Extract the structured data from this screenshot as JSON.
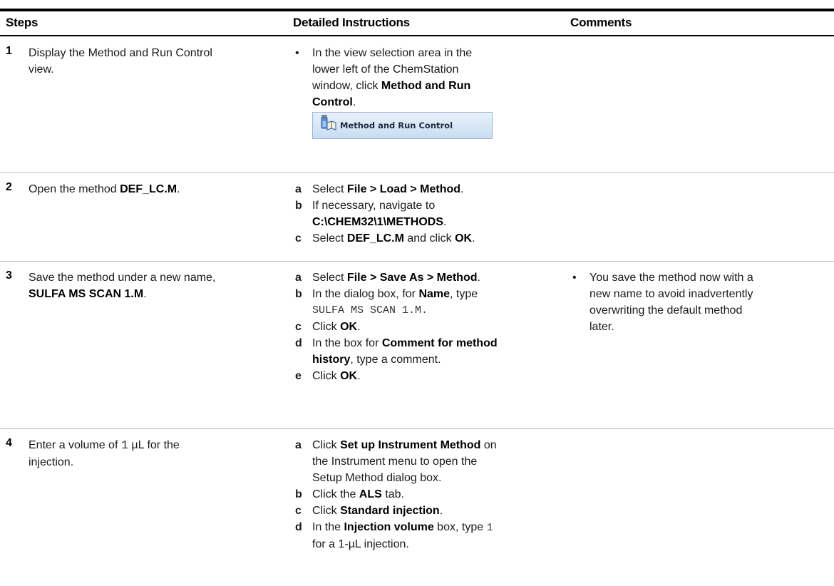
{
  "header": {
    "steps": "Steps",
    "instructions": "Detailed Instructions",
    "comments": "Comments"
  },
  "rows": [
    {
      "num": "1",
      "step_lines": [
        "Display the Method and Run Control",
        "view."
      ],
      "bullet": "•",
      "instr_line1": "In the view selection area in the",
      "instr_line2": "lower left of the ChemStation",
      "instr_line3a": "window, click ",
      "instr_bold1": "Method and Run",
      "instr_bold2": "Control",
      "instr_end": ".",
      "button_image_label": "Method and Run Control",
      "icon": "method-vial-book-icon"
    },
    {
      "num": "2",
      "step_a": "Open the method ",
      "step_b": "DEF_LC.M",
      "step_c": ".",
      "items": [
        {
          "letter": "a",
          "t1": "Select ",
          "b1": "File > Load > Method",
          "t2": "."
        },
        {
          "letter": "b",
          "t1": "If necessary, navigate to",
          "b1": "C:\\CHEM32\\1\\METHODS",
          "t2": "."
        },
        {
          "letter": "c",
          "t1": "Select ",
          "b1": "DEF_LC.M",
          "t2": " and click ",
          "b2": "OK",
          "t3": "."
        }
      ]
    },
    {
      "num": "3",
      "step_line1": "Save the method under a new name,",
      "step_bold": "SULFA MS SCAN 1.M",
      "step_end": ".",
      "items": [
        {
          "letter": "a",
          "t1": "Select ",
          "b1": "File > Save As > Method",
          "t2": "."
        },
        {
          "letter": "b",
          "t1": "In the dialog box, for ",
          "b1": "Name",
          "t2": ", type",
          "mono": "SULFA MS SCAN 1.M."
        },
        {
          "letter": "c",
          "t1": "Click ",
          "b1": "OK",
          "t2": "."
        },
        {
          "letter": "d",
          "t1": "In the box for ",
          "b1": "Comment for method",
          "b2": "history",
          "t2": ", type a comment."
        },
        {
          "letter": "e",
          "t1": "Click ",
          "b1": "OK",
          "t2": "."
        }
      ],
      "comment_bullet": "•",
      "comment_lines": [
        "You save the method now with a",
        "new name to avoid inadvertently",
        "overwriting the default method",
        "later."
      ]
    },
    {
      "num": "4",
      "step_line1a": "Enter a volume of ",
      "step_mono": "1",
      "step_line1b": " µL for the",
      "step_line2": "injection.",
      "items": [
        {
          "letter": "a",
          "t1": "Click ",
          "b1": "Set up Instrument Method",
          "t2": " on",
          "t3": "the Instrument menu to open the",
          "t4": "Setup Method dialog box."
        },
        {
          "letter": "b",
          "t1": "Click the ",
          "b1": "ALS",
          "t2": " tab."
        },
        {
          "letter": "c",
          "t1": "Click ",
          "b1": "Standard injection",
          "t2": "."
        },
        {
          "letter": "d",
          "t1": "In the ",
          "b1": "Injection volume",
          "t2": " box, type ",
          "mono": "1",
          "t3": "for a 1-µL injection."
        }
      ]
    }
  ]
}
